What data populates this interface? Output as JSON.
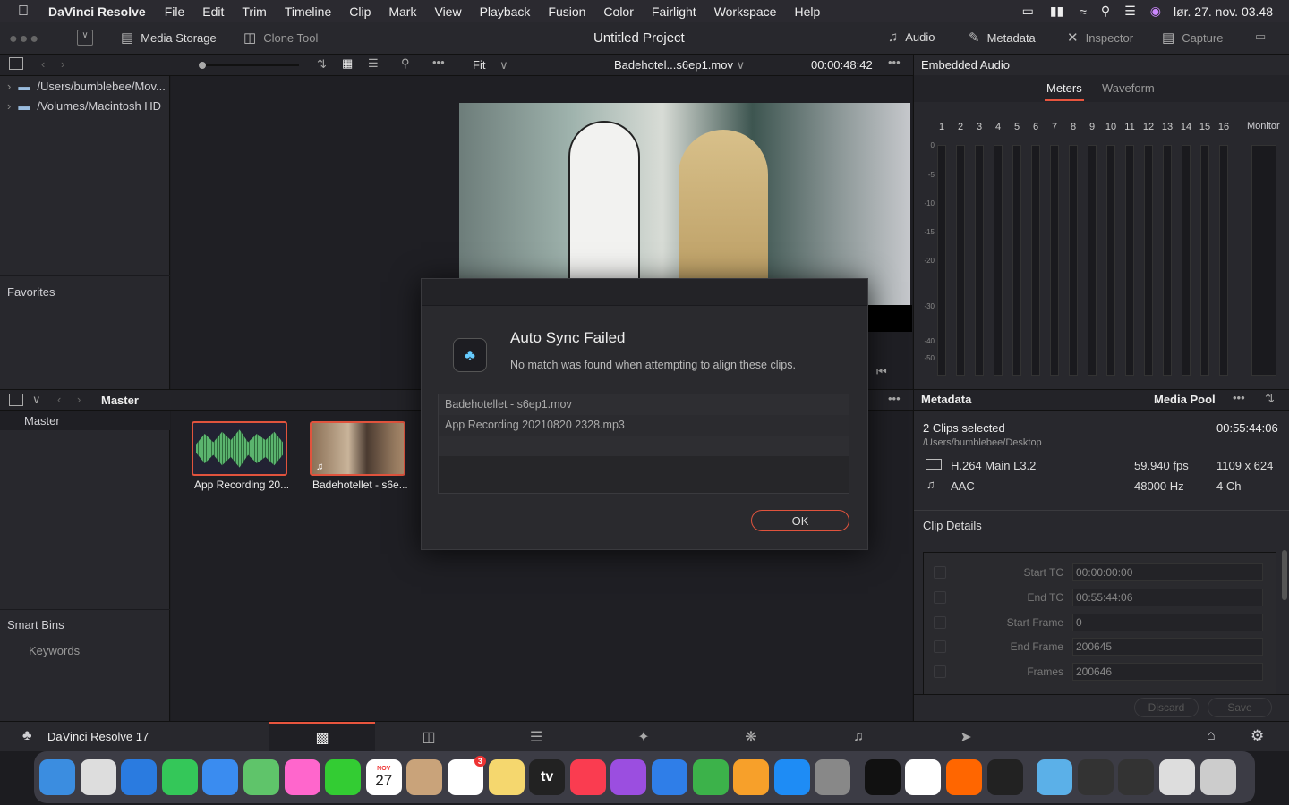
{
  "menubar": {
    "app": "DaVinci Resolve",
    "items": [
      "File",
      "Edit",
      "Trim",
      "Timeline",
      "Clip",
      "Mark",
      "View",
      "Playback",
      "Fusion",
      "Color",
      "Fairlight",
      "Workspace",
      "Help"
    ],
    "clock": "lør. 27. nov.  03.48"
  },
  "toolbar": {
    "media_storage": "Media Storage",
    "clone_tool": "Clone Tool",
    "project_title": "Untitled Project",
    "audio": "Audio",
    "metadata": "Metadata",
    "inspector": "Inspector",
    "capture": "Capture"
  },
  "viewer": {
    "zoom": "Fit",
    "clip_name": "Badehotel...s6ep1.mov",
    "timecode": "00:00:48:42"
  },
  "storage": {
    "locations": [
      "/Users/bumblebee/Mov...",
      "/Volumes/Macintosh HD"
    ],
    "favorites": "Favorites"
  },
  "audio_panel": {
    "title": "Embedded Audio",
    "tabs": [
      "Meters",
      "Waveform"
    ],
    "active_tab": "Meters",
    "channels": [
      "1",
      "2",
      "3",
      "4",
      "5",
      "6",
      "7",
      "8",
      "9",
      "10",
      "11",
      "12",
      "13",
      "14",
      "15",
      "16"
    ],
    "monitor": "Monitor",
    "db_scale": [
      "0",
      "-5",
      "-10",
      "-15",
      "-20",
      "-30",
      "-40",
      "-50"
    ]
  },
  "media_pool": {
    "bin": "Master",
    "bins": [
      "Master"
    ],
    "smart_bins": "Smart Bins",
    "keywords": "Keywords",
    "clips": [
      {
        "name": "App Recording 20..."
      },
      {
        "name": "Badehotellet - s6e..."
      }
    ]
  },
  "dialog": {
    "title": "Auto Sync Failed",
    "message": "No match was found when attempting to align these clips.",
    "clips": [
      "Badehotellet - s6ep1.mov",
      "App Recording 20210820 2328.mp3"
    ],
    "ok": "OK"
  },
  "metadata": {
    "title": "Metadata",
    "pool": "Media Pool",
    "selection": "2 Clips selected",
    "duration": "00:55:44:06",
    "path": "/Users/bumblebee/Desktop",
    "video_codec": "H.264 Main L3.2",
    "fps": "59.940 fps",
    "resolution": "1109 x 624",
    "audio_codec": "AAC",
    "sample_rate": "48000 Hz",
    "channels": "4 Ch",
    "section": "Clip Details",
    "fields": [
      {
        "label": "Start TC",
        "value": "00:00:00:00"
      },
      {
        "label": "End TC",
        "value": "00:55:44:06"
      },
      {
        "label": "Start Frame",
        "value": "0"
      },
      {
        "label": "End Frame",
        "value": "200645"
      },
      {
        "label": "Frames",
        "value": "200646"
      }
    ],
    "discard": "Discard",
    "save": "Save"
  },
  "footer": {
    "app_version": "DaVinci Resolve 17",
    "pages": [
      "media-icon",
      "cut-icon",
      "edit-icon",
      "fusion-icon",
      "color-icon",
      "fairlight-icon",
      "deliver-icon"
    ]
  },
  "dock": {
    "apps": [
      "Finder",
      "Launchpad",
      "Safari",
      "Messages",
      "Mail",
      "Maps",
      "Photos",
      "FaceTime",
      "Calendar",
      "Contacts",
      "Reminders",
      "Notes",
      "TV",
      "Music",
      "Podcasts",
      "Keynote",
      "Numbers",
      "Pages",
      "App Store",
      "System Preferences",
      "Spotify",
      "Swift",
      "Firefox",
      "DaVinci Resolve",
      "Folder",
      "Screen1",
      "Screen2",
      "Screen3",
      "Trash"
    ],
    "calendar_month": "NOV",
    "calendar_day": "27",
    "reminders_badge": "3",
    "tv_label": "tv"
  },
  "colors": {
    "accent": "#e8553e",
    "selection": "#e0533d"
  }
}
